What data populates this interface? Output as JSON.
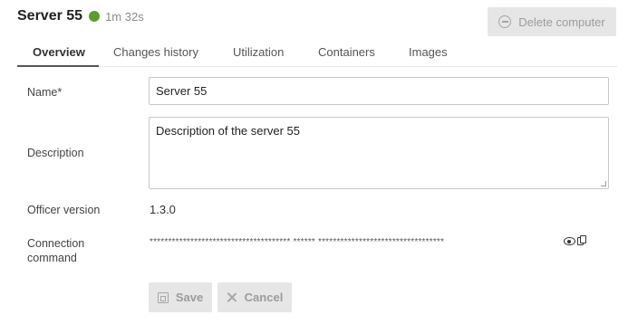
{
  "header": {
    "title": "Server 55",
    "status_color": "#5a9e2f",
    "uptime": "1m 32s",
    "delete_label": "Delete computer"
  },
  "tabs": [
    {
      "label": "Overview",
      "active": true
    },
    {
      "label": "Changes history",
      "active": false
    },
    {
      "label": "Utilization",
      "active": false
    },
    {
      "label": "Containers",
      "active": false
    },
    {
      "label": "Images",
      "active": false
    }
  ],
  "form": {
    "name_label": "Name*",
    "name_value": "Server 55",
    "description_label": "Description",
    "description_value": "Description of the server 55",
    "officer_version_label": "Officer version",
    "officer_version_value": "1.3.0",
    "connection_label_line1": "Connection",
    "connection_label_line2": "command",
    "connection_masked": "************************************** ****** **********************************"
  },
  "actions": {
    "save_label": "Save",
    "cancel_label": "Cancel"
  }
}
